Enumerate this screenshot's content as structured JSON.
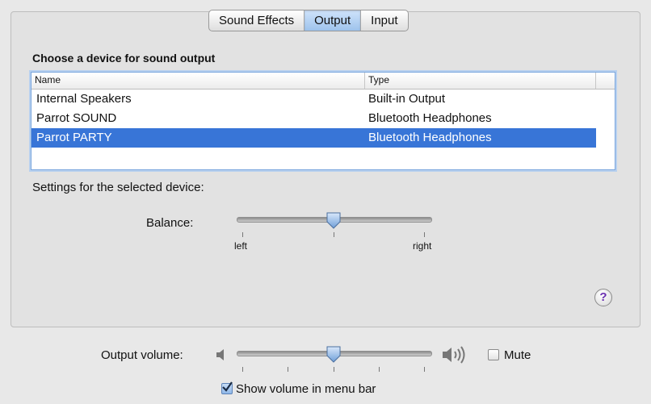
{
  "tabs": [
    "Sound Effects",
    "Output",
    "Input"
  ],
  "active_tab": "Output",
  "heading": "Choose a device for sound output",
  "table": {
    "columns": [
      "Name",
      "Type"
    ],
    "rows": [
      {
        "name": "Internal Speakers",
        "type": "Built-in Output"
      },
      {
        "name": "Parrot SOUND",
        "type": "Bluetooth Headphones"
      },
      {
        "name": "Parrot PARTY",
        "type": "Bluetooth Headphones"
      }
    ],
    "selected_row": 2
  },
  "settings_label": "Settings for the selected device:",
  "balance": {
    "label": "Balance:",
    "left_label": "left",
    "right_label": "right",
    "value": 0.5
  },
  "help_label": "?",
  "output_volume": {
    "label": "Output volume:",
    "value": 0.5,
    "mute_label": "Mute",
    "muted": false
  },
  "show_volume": {
    "label": "Show volume in menu bar",
    "checked": true
  },
  "icons": {
    "speaker_low": "speaker-low-icon",
    "speaker_high": "speaker-high-icon",
    "help": "help-icon",
    "check": "checkmark-icon"
  },
  "colors": {
    "selection": "#3875d7",
    "help_glyph": "#6a2fb0"
  }
}
